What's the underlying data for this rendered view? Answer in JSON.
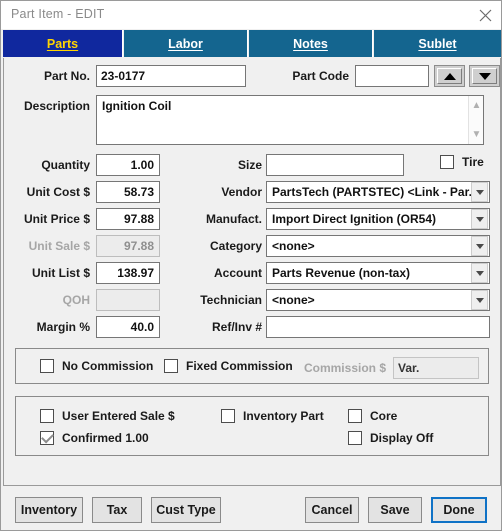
{
  "window": {
    "title": "Part Item - EDIT",
    "close_icon": "close-icon"
  },
  "tabs": [
    {
      "label": "Parts",
      "accel": "a",
      "active": true
    },
    {
      "label": "Labor",
      "accel": "L",
      "active": false
    },
    {
      "label": "Notes",
      "accel": "N",
      "active": false
    },
    {
      "label": "Sublet",
      "accel": "b",
      "active": false
    }
  ],
  "form": {
    "part_no_label": "Part No.",
    "part_no_value": "23-0177",
    "part_code_label": "Part Code",
    "part_code_value": "",
    "spin_up_icon": "triangle-up-icon",
    "spin_down_icon": "triangle-down-icon",
    "description_label": "Description",
    "description_value": "Ignition Coil",
    "scroll_up_icon": "chevron-up-icon",
    "scroll_down_icon": "chevron-down-icon",
    "quantity_label": "Quantity",
    "quantity_value": "1.00",
    "unit_cost_label": "Unit Cost $",
    "unit_cost_value": "58.73",
    "unit_price_label": "Unit Price $",
    "unit_price_value": "97.88",
    "unit_sale_label": "Unit Sale $",
    "unit_sale_value": "97.88",
    "unit_list_label": "Unit List $",
    "unit_list_value": "138.97",
    "qoh_label": "QOH",
    "qoh_value": "",
    "margin_label": "Margin %",
    "margin_value": "40.0",
    "size_label": "Size",
    "size_value": "",
    "tire_label": "Tire",
    "tire_checked": false,
    "vendor_label": "Vendor",
    "vendor_value": "PartsTech (PARTSTEC) <Link - Par...",
    "manufact_label": "Manufact.",
    "manufact_value": "Import Direct Ignition (OR54)",
    "category_label": "Category",
    "category_value": "<none>",
    "account_label": "Account",
    "account_value": "Parts Revenue (non-tax)",
    "technician_label": "Technician",
    "technician_value": "<none>",
    "refinv_label": "Ref/Inv #",
    "refinv_value": "",
    "dropdown_icon": "chevron-down-icon"
  },
  "commission_group": {
    "no_commission_label": "No Commission",
    "no_commission_checked": false,
    "fixed_commission_label": "Fixed Commission",
    "fixed_commission_checked": false,
    "commission_amount_label": "Commission $",
    "commission_amount_value": "Var."
  },
  "options_group": {
    "user_entered_sale_label": "User Entered Sale $",
    "user_entered_sale_checked": false,
    "confirmed_label": "Confirmed 1.00",
    "confirmed_checked": true,
    "inventory_part_label": "Inventory Part",
    "inventory_part_checked": false,
    "core_label": "Core",
    "core_checked": false,
    "display_off_label": "Display Off",
    "display_off_checked": false
  },
  "footer": {
    "inventory_label": "Inventory",
    "tax_label": "Tax",
    "cust_type_label": "Cust Type",
    "cancel_label": "Cancel",
    "save_label": "Save",
    "done_label": "Done"
  },
  "colors": {
    "tab_active_bg": "#10289e",
    "tab_active_fg": "#ffd400",
    "tab_inactive_bg": "#14658f",
    "primary_border": "#0f72c6",
    "dialog_bg": "#f0f0f0"
  }
}
